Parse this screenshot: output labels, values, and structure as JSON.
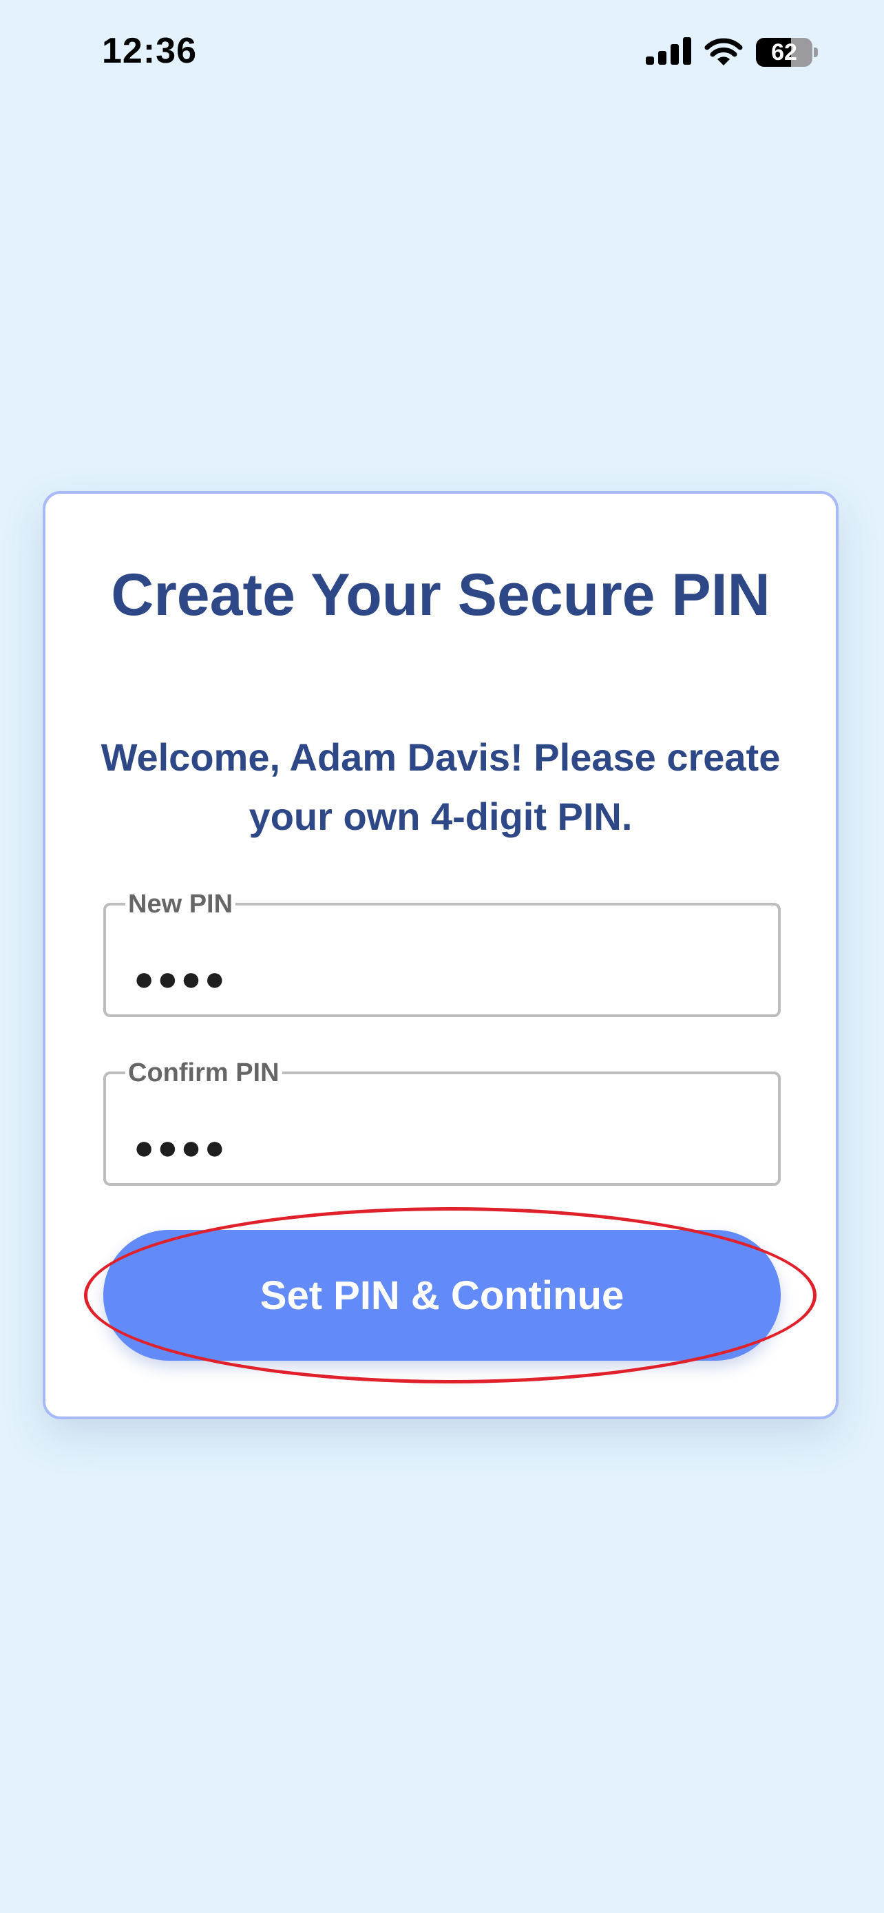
{
  "status_bar": {
    "time": "12:36",
    "battery_level": "62",
    "battery_fraction": 0.62,
    "icons": [
      "cellular-signal-icon",
      "wifi-icon",
      "battery-icon"
    ]
  },
  "card": {
    "title": "Create Your Secure PIN",
    "subtitle": "Welcome, Adam Davis! Please create your own 4-digit PIN."
  },
  "form": {
    "new_pin": {
      "label": "New PIN",
      "value": "●●●●"
    },
    "confirm_pin": {
      "label": "Confirm PIN",
      "value": "●●●●"
    },
    "submit_label": "Set PIN & Continue"
  },
  "colors": {
    "background": "#e3f2fc",
    "card_border": "#a7baf7",
    "heading": "#2d4787",
    "button": "#628af8",
    "highlight": "#e0202a"
  }
}
